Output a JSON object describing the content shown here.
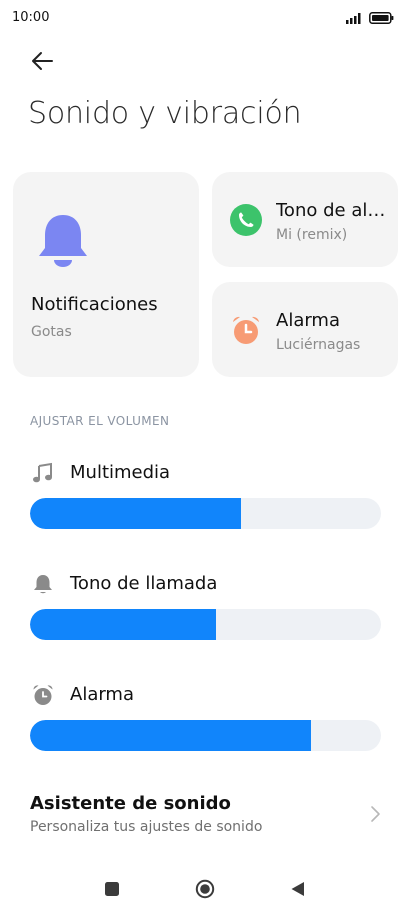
{
  "status_bar": {
    "time": "10:00"
  },
  "header": {
    "title": "Sonido y vibración"
  },
  "cards": {
    "notifications": {
      "title": "Notificaciones",
      "subtitle": "Gotas",
      "icon": "bell-icon",
      "color": "#7b86f2"
    },
    "ringtone": {
      "title": "Tono de alarma",
      "subtitle": "Mi (remix)",
      "icon": "phone-icon",
      "color": "#3cc36b"
    },
    "alarm": {
      "title": "Alarma",
      "subtitle": "Luciérnagas",
      "icon": "alarm-clock-icon",
      "color": "#f79b74"
    }
  },
  "volume": {
    "section_label": "AJUSTAR EL VOLUMEN",
    "media": {
      "label": "Multimedia",
      "level": 0.6,
      "icon": "music-note-icon"
    },
    "ring": {
      "label": "Tono de llamada",
      "level": 0.53,
      "icon": "bell-icon"
    },
    "alarm": {
      "label": "Alarma",
      "level": 0.8,
      "icon": "alarm-clock-icon"
    },
    "fill_color": "#1185fb",
    "track_color": "#eef1f5"
  },
  "assistant": {
    "title": "Asistente de sonido",
    "subtitle": "Personaliza tus ajustes de sonido"
  },
  "nav": {
    "recents": "square-icon",
    "home": "circle-icon",
    "back": "triangle-back-icon"
  }
}
